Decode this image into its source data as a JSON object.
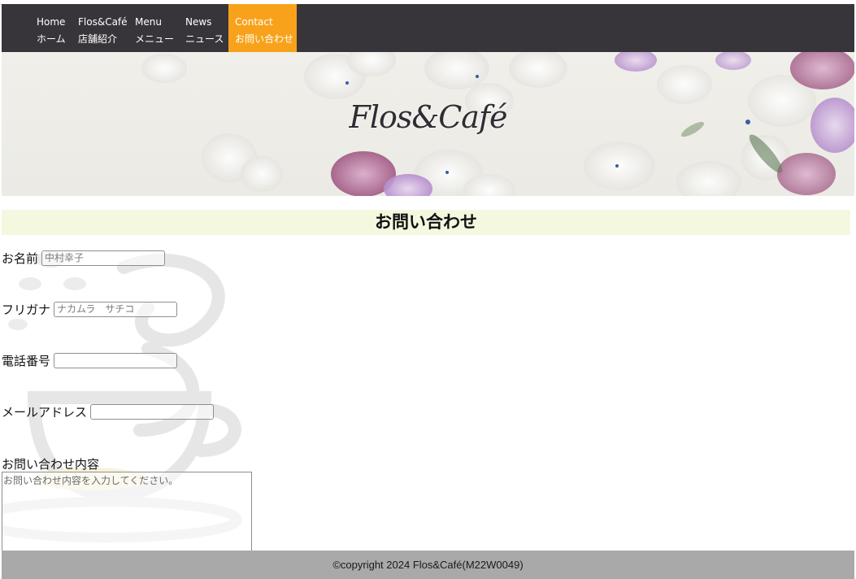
{
  "nav": {
    "items": [
      {
        "en": "Home",
        "jp": "ホーム"
      },
      {
        "en": "Flos&Café",
        "jp": "店舗紹介"
      },
      {
        "en": "Menu",
        "jp": "メニュー"
      },
      {
        "en": "News",
        "jp": "ニュース"
      },
      {
        "en": "Contact",
        "jp": "お問い合わせ",
        "active": true
      }
    ],
    "active_color": "#f8a21b",
    "background_color": "#38353a"
  },
  "hero": {
    "logo_text": "Flos&Café"
  },
  "section": {
    "title": "お問い合わせ",
    "title_background": "#f3f8df"
  },
  "form": {
    "name": {
      "label": "お名前",
      "placeholder": "中村幸子"
    },
    "furigana": {
      "label": "フリガナ",
      "placeholder": "ナカムラ　サチコ"
    },
    "phone": {
      "label": "電話番号",
      "placeholder": ""
    },
    "email": {
      "label": "メールアドレス",
      "placeholder": ""
    },
    "message": {
      "label": "お問い合わせ内容",
      "placeholder": "お問い合わせ内容を入力してください。"
    }
  },
  "footer": {
    "text": "©copyright 2024 Flos&Café(M22W0049)",
    "background_color": "#a9a9a9"
  }
}
